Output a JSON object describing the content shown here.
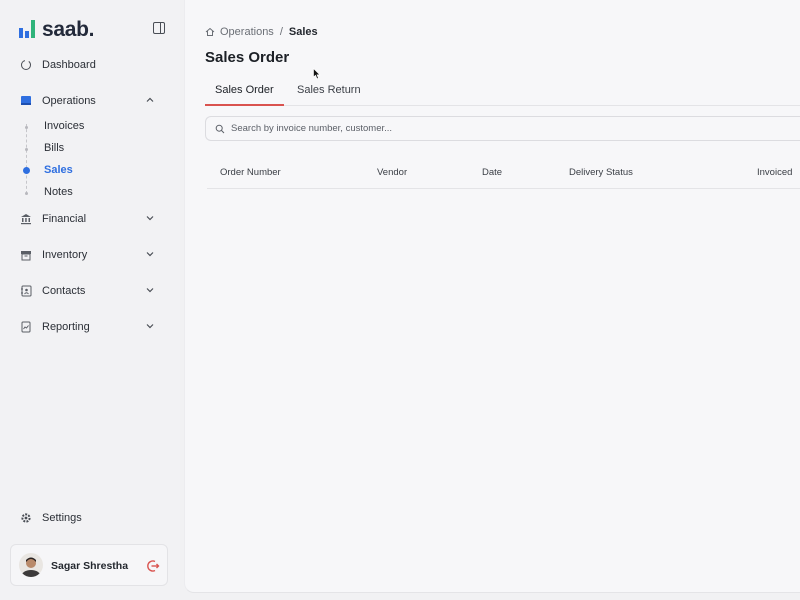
{
  "brand": {
    "name": "saab."
  },
  "sidebar": {
    "items": [
      {
        "label": "Dashboard"
      },
      {
        "label": "Operations"
      },
      {
        "label": "Financial"
      },
      {
        "label": "Inventory"
      },
      {
        "label": "Contacts"
      },
      {
        "label": "Reporting"
      }
    ],
    "operations_sub": [
      {
        "label": "Invoices"
      },
      {
        "label": "Bills"
      },
      {
        "label": "Sales"
      },
      {
        "label": "Notes"
      }
    ],
    "settings_label": "Settings"
  },
  "user": {
    "name": "Sagar Shrestha"
  },
  "breadcrumb": {
    "parent": "Operations",
    "separator": "/",
    "current": "Sales"
  },
  "page": {
    "title": "Sales Order"
  },
  "tabs": [
    {
      "label": "Sales Order"
    },
    {
      "label": "Sales Return"
    }
  ],
  "search": {
    "placeholder": "Search by invoice number, customer..."
  },
  "table": {
    "columns": [
      "Order Number",
      "Vendor",
      "Date",
      "Delivery Status",
      "Invoiced"
    ]
  },
  "colors": {
    "accent": "#2f6fe0",
    "tab_underline": "#d9534f",
    "logout": "#d9534f"
  }
}
